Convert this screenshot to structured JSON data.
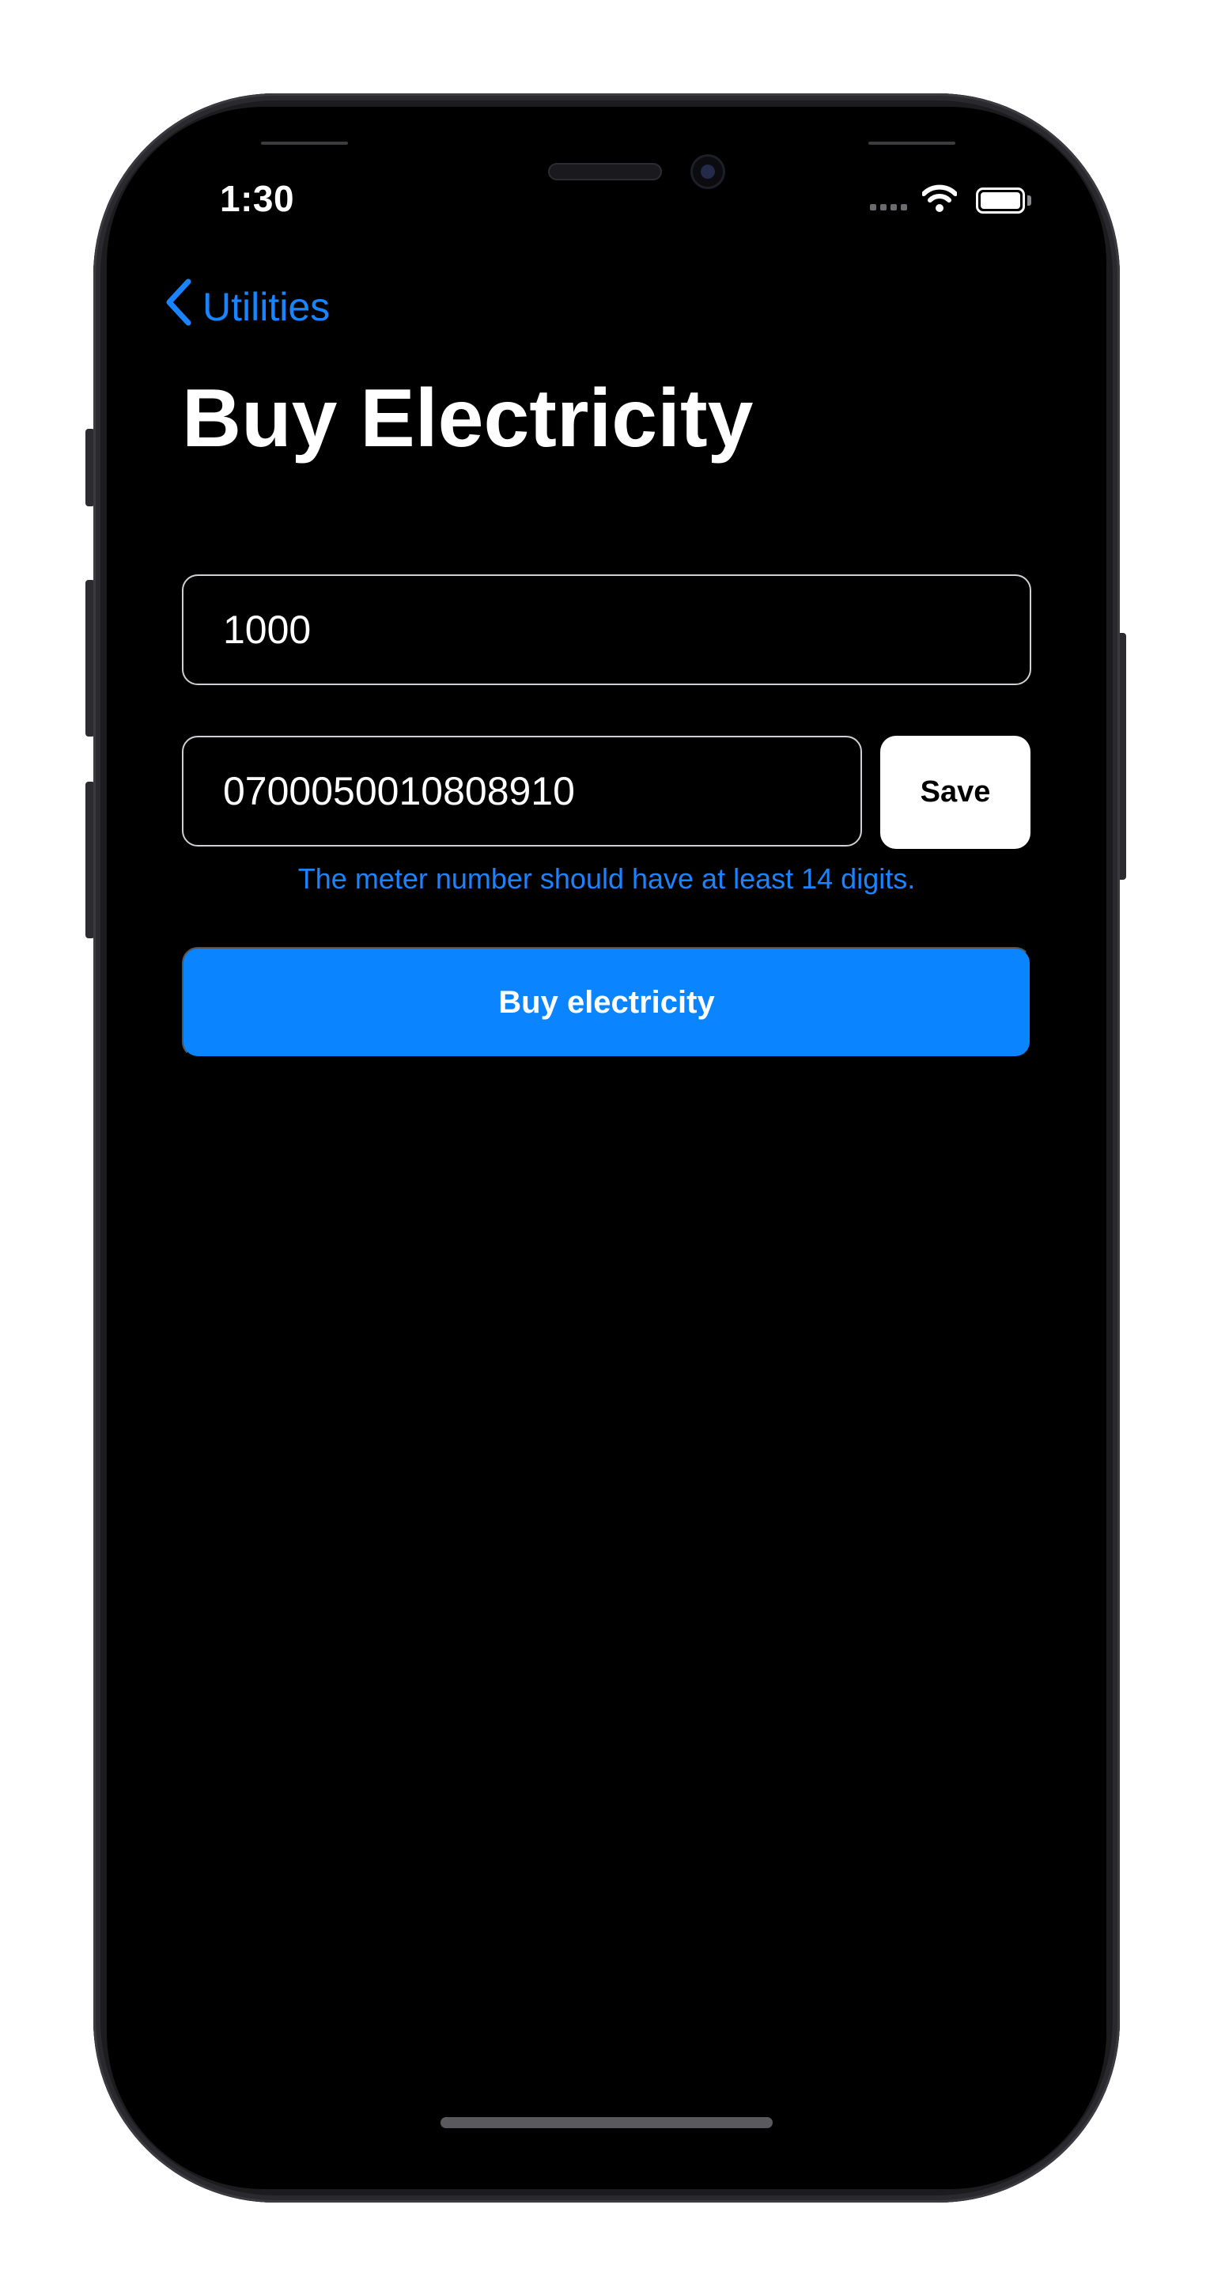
{
  "status_bar": {
    "time": "1:30",
    "icons": [
      "cellular-signal-icon",
      "wifi-icon",
      "battery-icon"
    ]
  },
  "nav": {
    "back_label": "Utilities",
    "back_icon": "chevron-left-icon"
  },
  "page": {
    "title": "Buy Electricity"
  },
  "form": {
    "amount_value": "1000",
    "meter_number_value": "0700050010808910",
    "save_label": "Save",
    "error_message": "The meter number should have at least 14 digits.",
    "buy_label": "Buy electricity"
  },
  "colors": {
    "accent": "#0a84ff",
    "link": "#1a84ff",
    "background": "#000000",
    "text": "#ffffff"
  }
}
